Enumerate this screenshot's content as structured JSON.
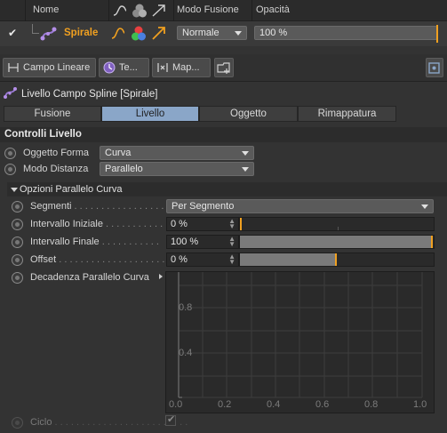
{
  "field_list": {
    "columns": {
      "name": "Nome",
      "blend_mode": "Modo Fusione",
      "opacity": "Opacità"
    },
    "row": {
      "name": "Spirale",
      "blend_mode": "Normale",
      "opacity": "100 %"
    }
  },
  "field_tabs": [
    {
      "label": "Campo Lineare"
    },
    {
      "label": "Te..."
    },
    {
      "label": "Map..."
    }
  ],
  "layer": {
    "title": "Livello Campo Spline [Spirale]"
  },
  "tabs": [
    "Fusione",
    "Livello",
    "Oggetto",
    "Rimappatura"
  ],
  "active_tab": "Livello",
  "controls": {
    "section_title": "Controlli Livello",
    "shape_object_label": "Oggetto Forma",
    "shape_object_value": "Curva",
    "distance_mode_label": "Modo Distanza",
    "distance_mode_value": "Parallelo"
  },
  "parallel": {
    "section_title": "Opzioni Parallelo Curva",
    "segments_label": "Segmenti",
    "segments_value": "Per Segmento",
    "start_label": "Intervallo Iniziale",
    "start_value": "0 %",
    "start_fraction": 0,
    "end_label": "Intervallo Finale",
    "end_value": "100 %",
    "end_fraction": 1,
    "offset_label": "Offset",
    "offset_value": "0 %",
    "offset_fraction": 0.5,
    "falloff_label": "Decadenza Parallelo Curva",
    "loop_label": "Ciclo"
  },
  "graph": {
    "y_ticks": [
      "0.8",
      "0.4"
    ],
    "x_ticks": [
      "0.0",
      "0.2",
      "0.4",
      "0.6",
      "0.8",
      "1.0"
    ]
  },
  "colors": {
    "accent": "#f0a020",
    "active_tab": "#8aa6c8",
    "name_color": "#f0a020"
  }
}
